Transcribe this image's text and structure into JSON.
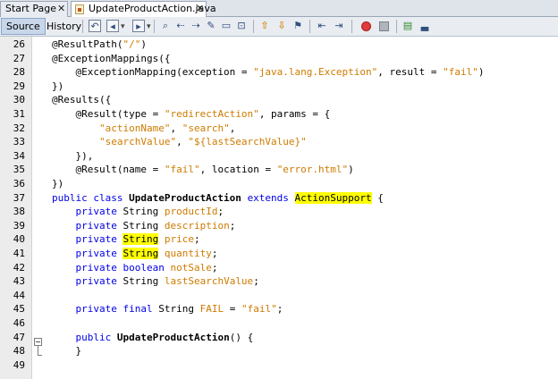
{
  "tabs": [
    {
      "label": "Start Page",
      "close": "✕"
    },
    {
      "label": "UpdateProductAction.java",
      "close": "✕"
    }
  ],
  "toolbar": {
    "source_label": "Source",
    "history_label": "History"
  },
  "editor": {
    "lines": [
      {
        "num": "26",
        "tokens": [
          {
            "t": "@ResultPath(",
            "c": "ann"
          },
          {
            "t": "\"/\"",
            "c": "str"
          },
          {
            "t": ")",
            "c": ""
          }
        ]
      },
      {
        "num": "27",
        "tokens": [
          {
            "t": "@ExceptionMappings({",
            "c": "ann"
          }
        ]
      },
      {
        "num": "28",
        "tokens": [
          {
            "t": "    @ExceptionMapping(exception = ",
            "c": "ann"
          },
          {
            "t": "\"java.lang.Exception\"",
            "c": "str"
          },
          {
            "t": ", result = ",
            "c": ""
          },
          {
            "t": "\"fail\"",
            "c": "str"
          },
          {
            "t": ")",
            "c": ""
          }
        ]
      },
      {
        "num": "29",
        "tokens": [
          {
            "t": "})",
            "c": ""
          }
        ]
      },
      {
        "num": "30",
        "tokens": [
          {
            "t": "@Results({",
            "c": "ann"
          }
        ]
      },
      {
        "num": "31",
        "tokens": [
          {
            "t": "    @Result(type = ",
            "c": "ann"
          },
          {
            "t": "\"redirectAction\"",
            "c": "str"
          },
          {
            "t": ", params = {",
            "c": ""
          }
        ]
      },
      {
        "num": "32",
        "tokens": [
          {
            "t": "        ",
            "c": ""
          },
          {
            "t": "\"actionName\"",
            "c": "str"
          },
          {
            "t": ", ",
            "c": ""
          },
          {
            "t": "\"search\"",
            "c": "str"
          },
          {
            "t": ",",
            "c": ""
          }
        ]
      },
      {
        "num": "33",
        "tokens": [
          {
            "t": "        ",
            "c": ""
          },
          {
            "t": "\"searchValue\"",
            "c": "str"
          },
          {
            "t": ", ",
            "c": ""
          },
          {
            "t": "\"${lastSearchValue}\"",
            "c": "str"
          }
        ]
      },
      {
        "num": "34",
        "tokens": [
          {
            "t": "    }),",
            "c": ""
          }
        ]
      },
      {
        "num": "35",
        "tokens": [
          {
            "t": "    @Result(name = ",
            "c": "ann"
          },
          {
            "t": "\"fail\"",
            "c": "str"
          },
          {
            "t": ", location = ",
            "c": ""
          },
          {
            "t": "\"error.html\"",
            "c": "str"
          },
          {
            "t": ")",
            "c": ""
          }
        ]
      },
      {
        "num": "36",
        "tokens": [
          {
            "t": "})",
            "c": ""
          }
        ]
      },
      {
        "num": "37",
        "tokens": [
          {
            "t": "public class ",
            "c": "kw"
          },
          {
            "t": "UpdateProductAction",
            "c": "bold"
          },
          {
            "t": " ",
            "c": ""
          },
          {
            "t": "extends",
            "c": "kw"
          },
          {
            "t": " ",
            "c": ""
          },
          {
            "t": "ActionSupport",
            "c": "hl"
          },
          {
            "t": " {",
            "c": ""
          }
        ]
      },
      {
        "num": "38",
        "tokens": [
          {
            "t": "    ",
            "c": ""
          },
          {
            "t": "private",
            "c": "kw"
          },
          {
            "t": " String ",
            "c": ""
          },
          {
            "t": "productId",
            "c": "str"
          },
          {
            "t": ";",
            "c": ""
          }
        ]
      },
      {
        "num": "39",
        "tokens": [
          {
            "t": "    ",
            "c": ""
          },
          {
            "t": "private",
            "c": "kw"
          },
          {
            "t": " String ",
            "c": ""
          },
          {
            "t": "description",
            "c": "str"
          },
          {
            "t": ";",
            "c": ""
          }
        ]
      },
      {
        "num": "40",
        "tokens": [
          {
            "t": "    ",
            "c": ""
          },
          {
            "t": "private",
            "c": "kw"
          },
          {
            "t": " ",
            "c": ""
          },
          {
            "t": "String",
            "c": "hl"
          },
          {
            "t": " ",
            "c": ""
          },
          {
            "t": "price",
            "c": "str"
          },
          {
            "t": ";",
            "c": ""
          }
        ]
      },
      {
        "num": "41",
        "tokens": [
          {
            "t": "    ",
            "c": ""
          },
          {
            "t": "private",
            "c": "kw"
          },
          {
            "t": " ",
            "c": ""
          },
          {
            "t": "String",
            "c": "hl"
          },
          {
            "t": " ",
            "c": ""
          },
          {
            "t": "quantity",
            "c": "str"
          },
          {
            "t": ";",
            "c": ""
          }
        ]
      },
      {
        "num": "42",
        "tokens": [
          {
            "t": "    ",
            "c": ""
          },
          {
            "t": "private",
            "c": "kw"
          },
          {
            "t": " ",
            "c": ""
          },
          {
            "t": "boolean",
            "c": "kw"
          },
          {
            "t": " ",
            "c": ""
          },
          {
            "t": "notSale",
            "c": "str"
          },
          {
            "t": ";",
            "c": ""
          }
        ]
      },
      {
        "num": "43",
        "tokens": [
          {
            "t": "    ",
            "c": ""
          },
          {
            "t": "private",
            "c": "kw"
          },
          {
            "t": " String ",
            "c": ""
          },
          {
            "t": "lastSearchValue",
            "c": "str"
          },
          {
            "t": ";",
            "c": ""
          }
        ]
      },
      {
        "num": "44",
        "tokens": []
      },
      {
        "num": "45",
        "tokens": [
          {
            "t": "    ",
            "c": ""
          },
          {
            "t": "private",
            "c": "kw"
          },
          {
            "t": " ",
            "c": ""
          },
          {
            "t": "final",
            "c": "kw"
          },
          {
            "t": " String ",
            "c": ""
          },
          {
            "t": "FAIL",
            "c": "str"
          },
          {
            "t": " = ",
            "c": ""
          },
          {
            "t": "\"fail\"",
            "c": "str"
          },
          {
            "t": ";",
            "c": ""
          }
        ]
      },
      {
        "num": "46",
        "tokens": []
      },
      {
        "num": "47",
        "tokens": [
          {
            "t": "    ",
            "c": ""
          },
          {
            "t": "public",
            "c": "kw"
          },
          {
            "t": " ",
            "c": ""
          },
          {
            "t": "UpdateProductAction",
            "c": "bold"
          },
          {
            "t": "() {",
            "c": ""
          }
        ]
      },
      {
        "num": "48",
        "tokens": [
          {
            "t": "    }",
            "c": ""
          }
        ]
      },
      {
        "num": "49",
        "tokens": []
      }
    ]
  },
  "colors": {
    "keyword": "#0000e6",
    "string": "#ce7b00",
    "highlight": "#ffff00",
    "gutter": "#ececec"
  }
}
